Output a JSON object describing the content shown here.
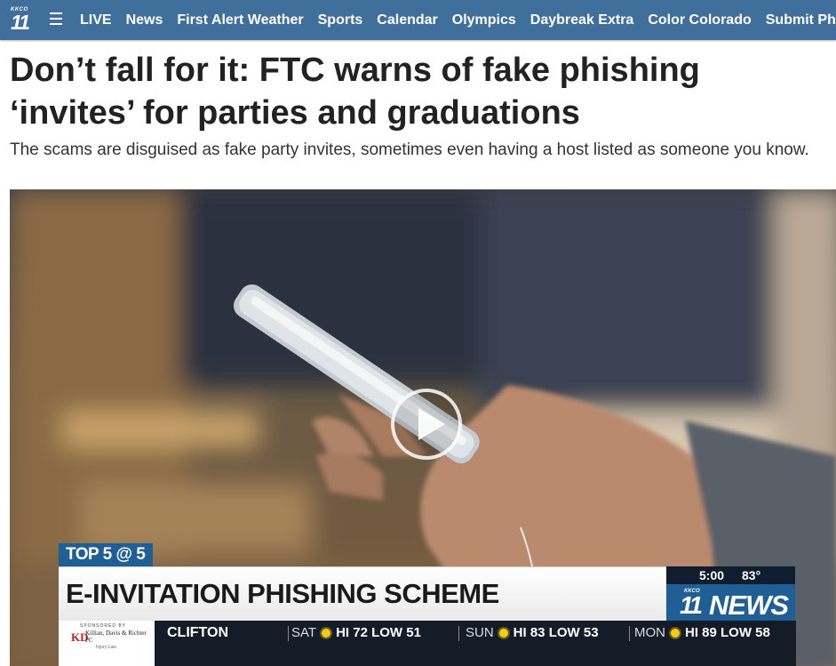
{
  "nav": {
    "logo_small": "KKCO",
    "logo_number": "11",
    "items": [
      {
        "label": "LIVE"
      },
      {
        "label": "News"
      },
      {
        "label": "First Alert Weather"
      },
      {
        "label": "Sports"
      },
      {
        "label": "Calendar"
      },
      {
        "label": "Olympics"
      },
      {
        "label": "Daybreak Extra"
      },
      {
        "label": "Color Colorado"
      },
      {
        "label": "Submit Ph"
      }
    ],
    "menu_icon": "hamburger-menu-icon"
  },
  "article": {
    "headline": "Don’t fall for it: FTC warns of fake phishing ‘invites’ for parties and graduations",
    "dek": "The scams are disguised as fake party invites, sometimes even having a host listed as someone you know."
  },
  "video": {
    "play_icon": "play-icon",
    "segment_tag": "TOP 5 @ 5",
    "lower_third": "E-INVITATION PHISHING SCHEME",
    "time": "5:00",
    "temp": "83°",
    "logo_small": "KKCO",
    "logo_number": "11",
    "logo_word": "NEWS",
    "sponsor": {
      "top": "SPONSORED BY",
      "name": "Killian, Davis & Richter PC",
      "sub": "Injury Law",
      "mark": "KD"
    },
    "ticker": {
      "city": "CLIFTON",
      "days": [
        {
          "day": "SAT",
          "hilo": "HI 72 LOW 51",
          "icon": "partly-cloudy-icon"
        },
        {
          "day": "SUN",
          "hilo": "HI 83 LOW 53",
          "icon": "sun-icon"
        },
        {
          "day": "MON",
          "hilo": "HI 89 LOW 58",
          "icon": "sun-icon"
        }
      ]
    }
  },
  "colors": {
    "nav_bg": "#3f6f9a",
    "brand_blue": "#1f5f95",
    "ticker_bg": "#141c28"
  }
}
